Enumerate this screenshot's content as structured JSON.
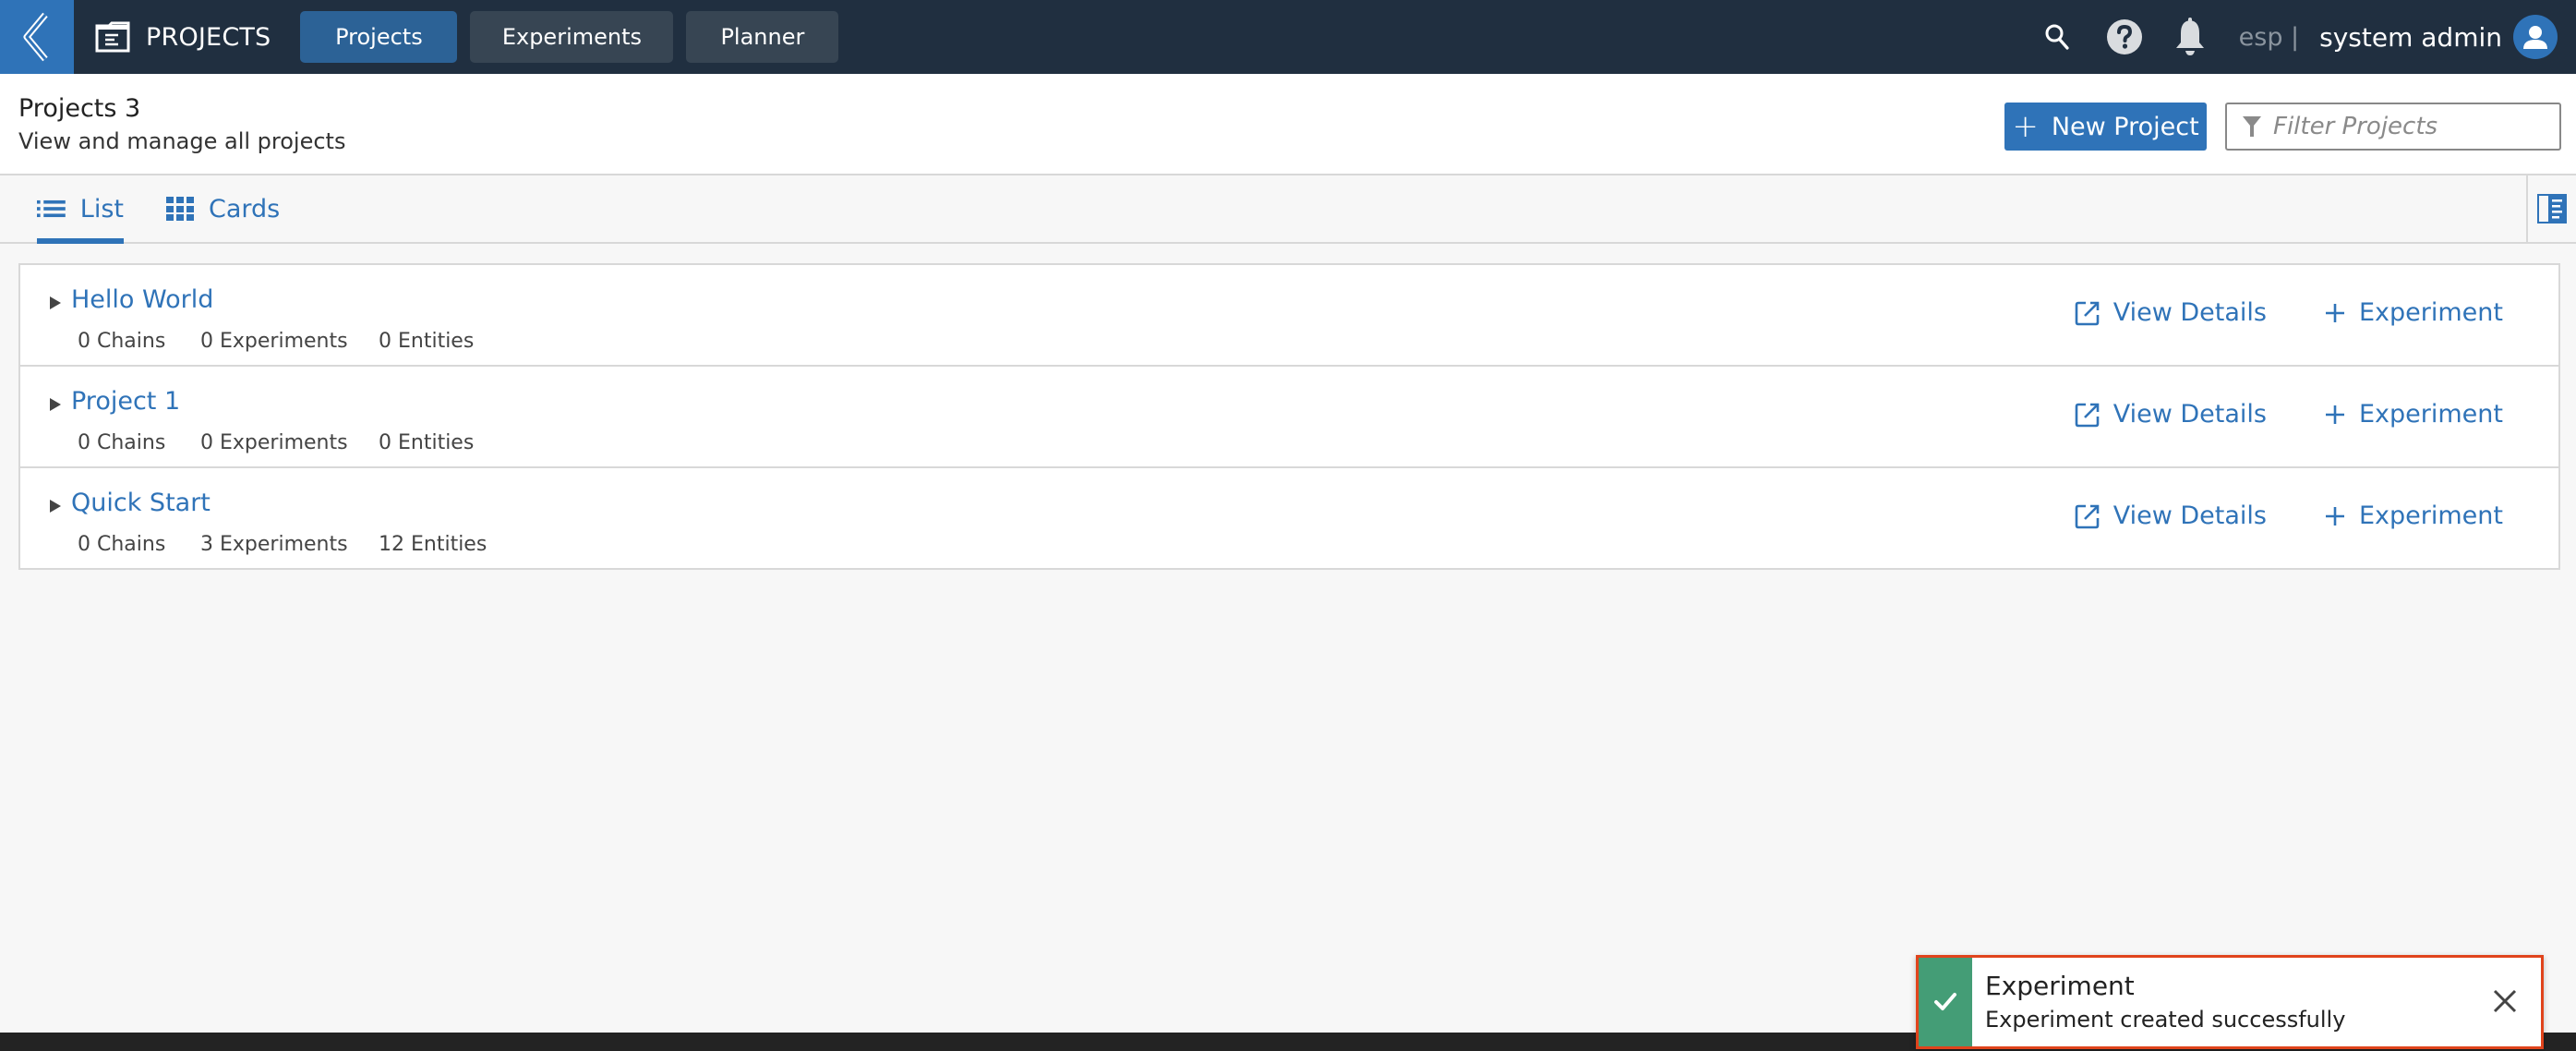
{
  "topnav": {
    "back_icon": "chevron-left-icon",
    "app_icon": "document-icon",
    "app_title": "PROJECTS",
    "tabs": [
      {
        "label": "Projects",
        "active": true
      },
      {
        "label": "Experiments",
        "active": false
      },
      {
        "label": "Planner",
        "active": false
      }
    ],
    "search_icon": "search-icon",
    "help_icon": "help-icon",
    "notifications_icon": "bell-icon",
    "lang": "esp |",
    "user_name": "system admin",
    "avatar_icon": "user-icon"
  },
  "header": {
    "title": "Projects 3",
    "subtitle": "View and manage all projects",
    "new_project_plus": "+",
    "new_project_label": "New Project",
    "filter_placeholder": "Filter Projects",
    "filter_value": ""
  },
  "view_tabs": {
    "list_label": "List",
    "cards_label": "Cards",
    "active": "List"
  },
  "projects": [
    {
      "name": "Hello World",
      "chains": "0 Chains",
      "experiments": "0 Experiments",
      "entities": "0 Entities",
      "view_details": "View Details",
      "add_experiment": "Experiment"
    },
    {
      "name": "Project 1",
      "chains": "0 Chains",
      "experiments": "0 Experiments",
      "entities": "0 Entities",
      "view_details": "View Details",
      "add_experiment": "Experiment"
    },
    {
      "name": "Quick Start",
      "chains": "0 Chains",
      "experiments": "3 Experiments",
      "entities": "12 Entities",
      "view_details": "View Details",
      "add_experiment": "Experiment"
    }
  ],
  "toast": {
    "title": "Experiment",
    "message": "Experiment created successfully",
    "status": "success"
  },
  "colors": {
    "nav_bg": "#202f40",
    "brand_blue": "#2f73b8",
    "active_tab": "#2c6296",
    "inactive_tab": "#374553",
    "success_green": "#449d76",
    "toast_border": "#e0441c"
  }
}
